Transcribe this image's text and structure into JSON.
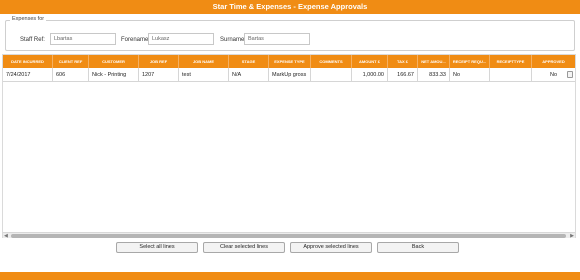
{
  "window": {
    "title": "Star Time & Expenses - Expense Approvals"
  },
  "filters": {
    "group_label": "Expenses for",
    "staff_ref_label": "Staff Ref:",
    "staff_ref_value": "Lbartas",
    "forename_label": "Forename:",
    "forename_value": "Lukasz",
    "surname_label": "Surname:",
    "surname_value": "Bartas"
  },
  "table": {
    "columns": [
      "DATE INCURRED",
      "CLIENT REF",
      "CUSTOMER",
      "JOB REF",
      "JOB NAME",
      "STAGE",
      "EXPENSE TYPE",
      "COMMENTS",
      "AMOUNT £",
      "TAX £",
      "NET AMOU...",
      "RECEIPT REQU...",
      "RECEIPTTYPE",
      "APPROVED"
    ],
    "rows": [
      [
        "7/24/2017",
        "606",
        "Nick - Printing",
        "1207",
        "test",
        "N/A",
        "MarkUp gross",
        "",
        "1,000.00",
        "166.67",
        "833.33",
        "No",
        "",
        "No"
      ]
    ]
  },
  "buttons": {
    "select_all": "Select all lines",
    "clear_selected": "Clear selected lines",
    "approve_selected": "Approve selected lines",
    "back": "Back"
  },
  "colors": {
    "accent": "#f08c14"
  },
  "icons": {
    "row_action": "document-icon"
  }
}
